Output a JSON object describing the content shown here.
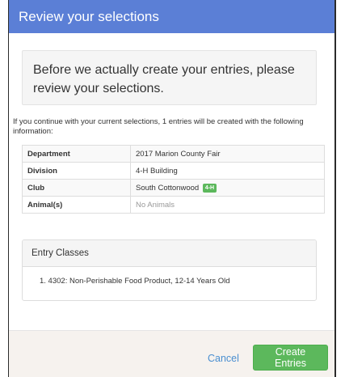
{
  "modal": {
    "title": "Review your selections",
    "callout": "Before we actually create your entries, please review your selections.",
    "intro": "If you continue with your current selections, 1 entries will be created with the following information:",
    "details": {
      "department_label": "Department",
      "department_value": "2017 Marion County Fair",
      "division_label": "Division",
      "division_value": "4-H Building",
      "club_label": "Club",
      "club_value": "South Cottonwood",
      "club_badge": "4-H",
      "animals_label": "Animal(s)",
      "animals_value": "No Animals"
    },
    "entry_classes": {
      "heading": "Entry Classes",
      "items": [
        "1. 4302: Non-Perishable Food Product, 12-14 Years Old"
      ]
    },
    "footer": {
      "cancel_label": "Cancel",
      "create_label": "Create Entries"
    }
  },
  "colors": {
    "header": "#5b7fd6",
    "primary_green": "#5cb85c",
    "link_blue": "#4a8fd0"
  }
}
